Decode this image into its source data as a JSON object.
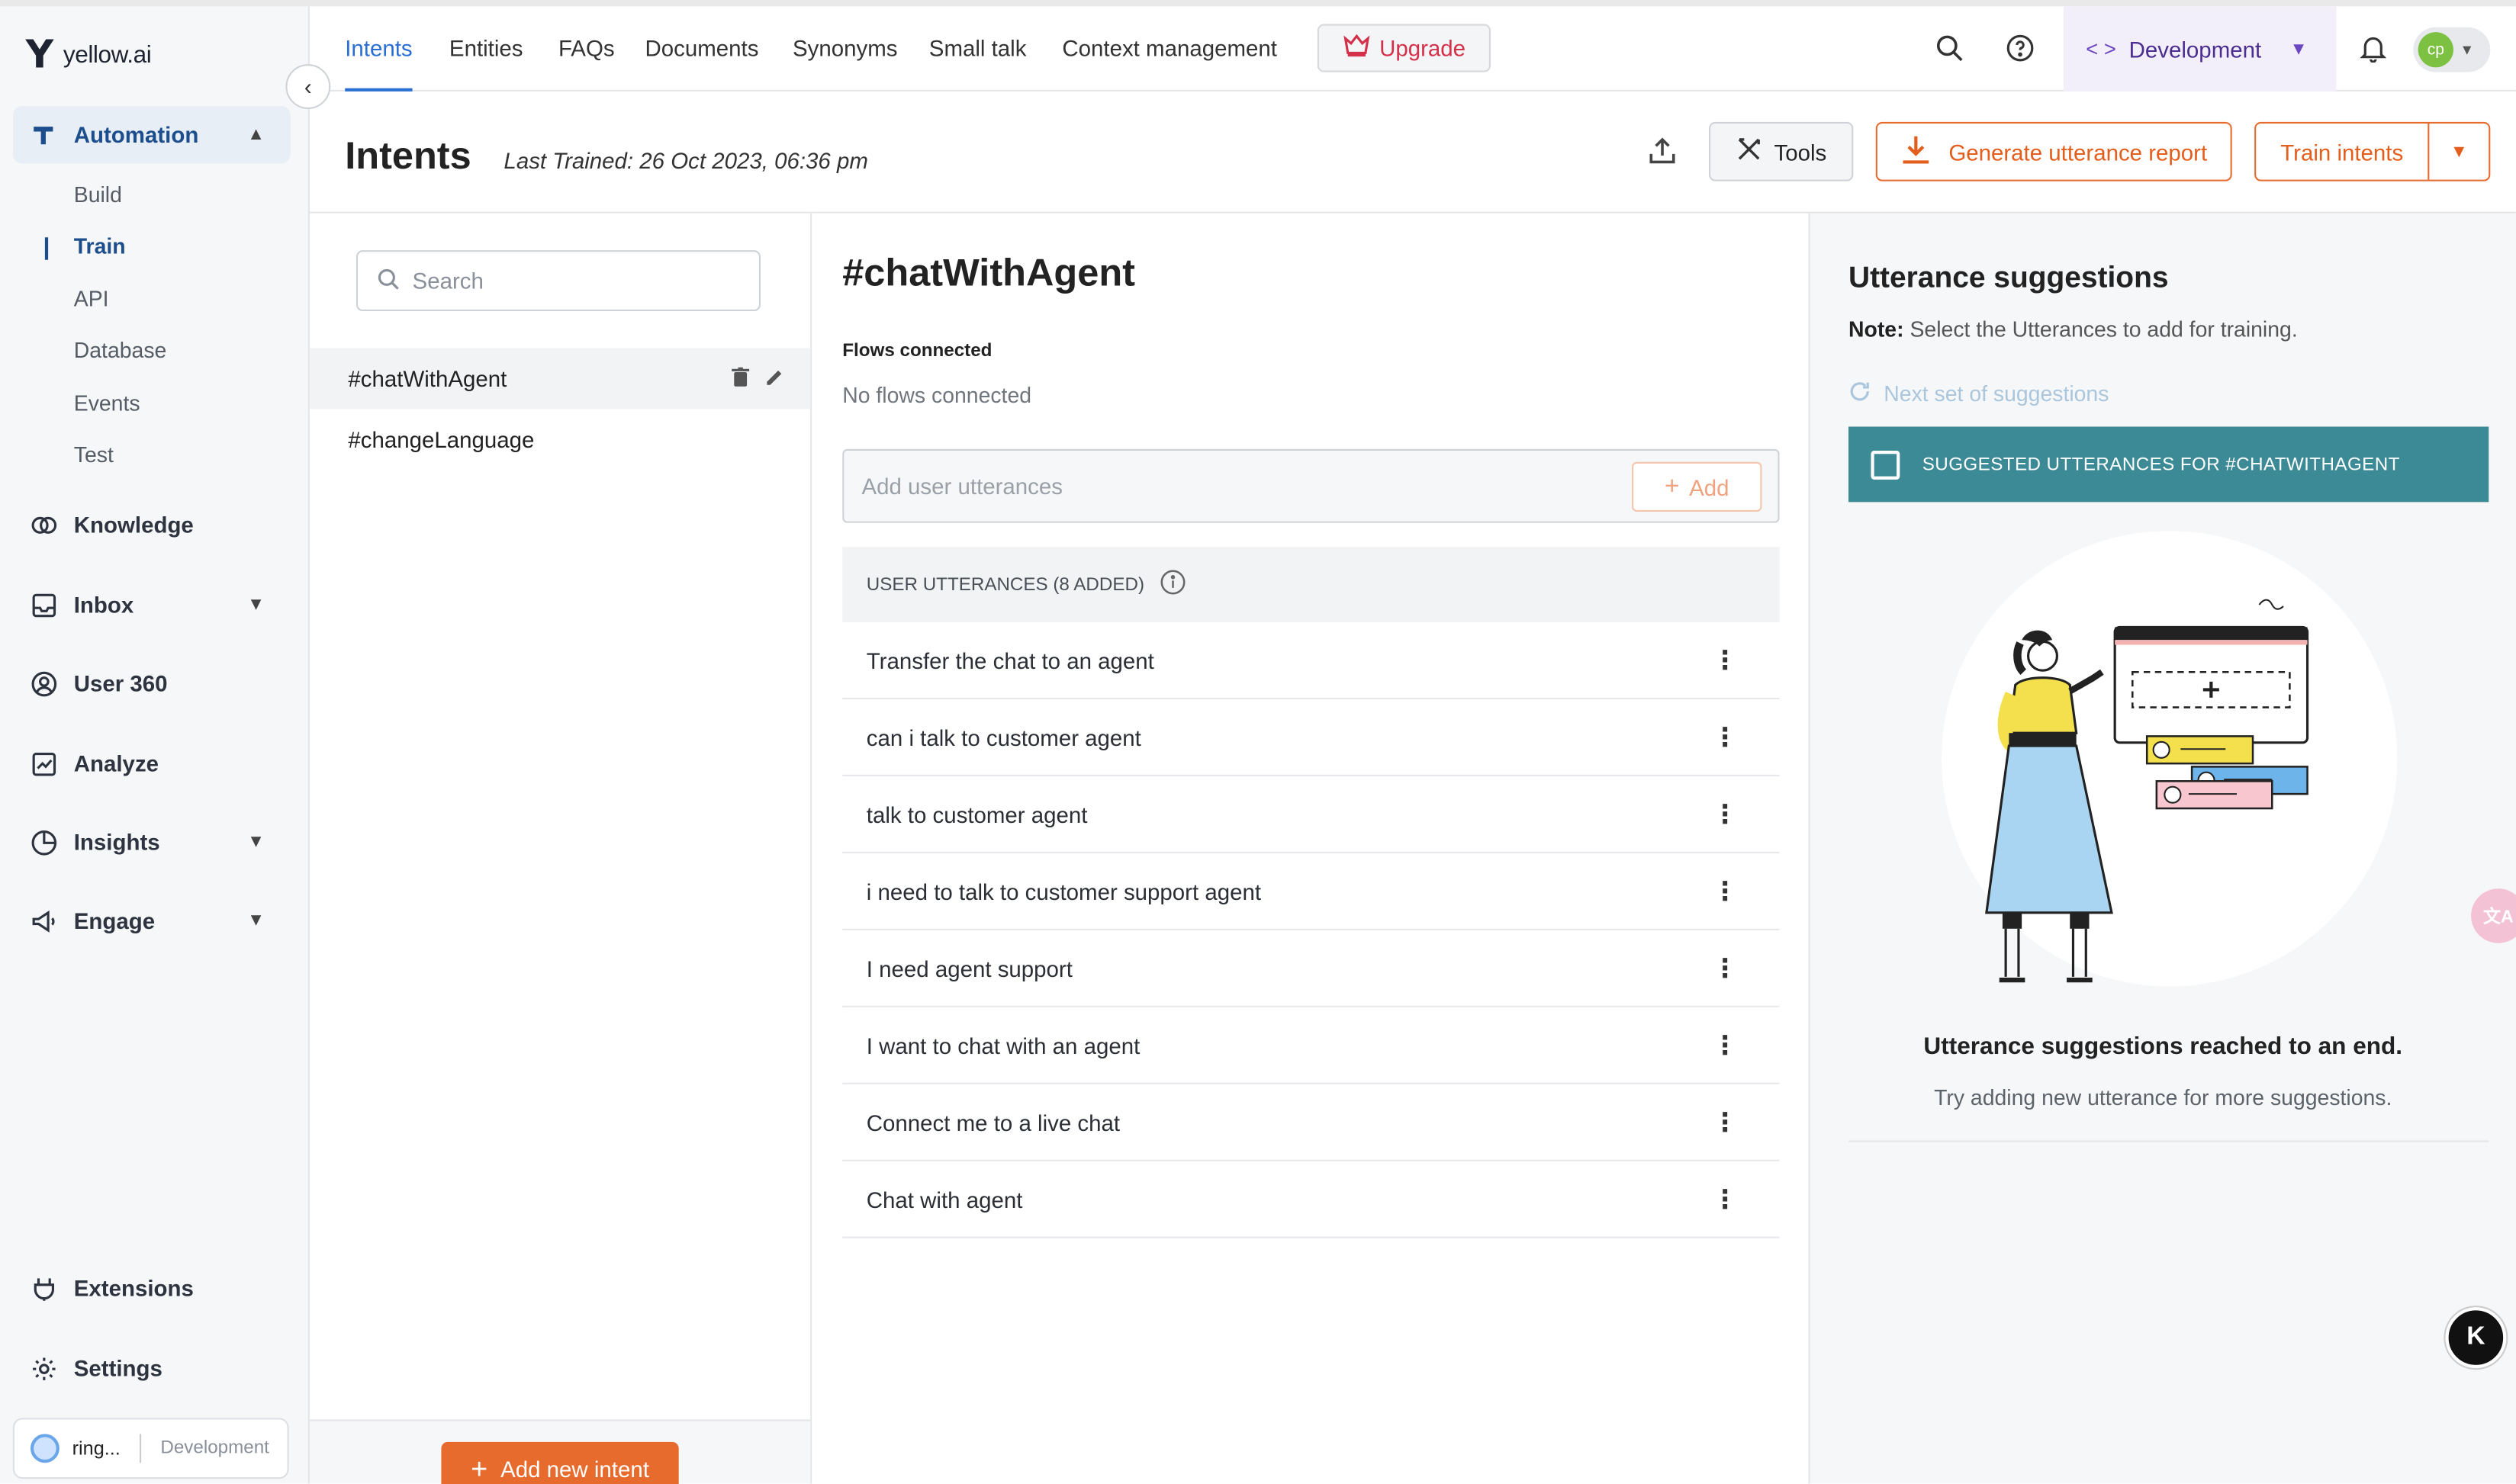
{
  "brand": {
    "name": "yellow.ai"
  },
  "sidebar": {
    "sections": [
      {
        "label": "Automation",
        "icon": "automation-icon",
        "expanded": true
      },
      {
        "label": "Knowledge",
        "icon": "brain-icon"
      },
      {
        "label": "Inbox",
        "icon": "inbox-icon"
      },
      {
        "label": "User 360",
        "icon": "user-circle-icon"
      },
      {
        "label": "Analyze",
        "icon": "chart-icon"
      },
      {
        "label": "Insights",
        "icon": "pie-icon"
      },
      {
        "label": "Engage",
        "icon": "megaphone-icon"
      }
    ],
    "sub_items": [
      "Build",
      "Train",
      "API",
      "Database",
      "Events",
      "Test"
    ],
    "active_sub": "Train",
    "bottom": [
      {
        "label": "Extensions",
        "icon": "plug-icon"
      },
      {
        "label": "Settings",
        "icon": "gear-icon"
      }
    ],
    "workspace": {
      "name": "ring...",
      "env": "Development"
    }
  },
  "topnav": {
    "tabs": [
      "Intents",
      "Entities",
      "FAQs",
      "Documents",
      "Synonyms",
      "Small talk",
      "Context management"
    ],
    "active_tab": "Intents",
    "upgrade_label": "Upgrade",
    "environment": "Development",
    "user_initials": "cp"
  },
  "header": {
    "title": "Intents",
    "last_trained": "Last Trained: 26 Oct 2023, 06:36 pm",
    "tools_label": "Tools",
    "generate_label": "Generate utterance report",
    "train_label": "Train intents"
  },
  "intent_list": {
    "search_placeholder": "Search",
    "items": [
      "#chatWithAgent",
      "#changeLanguage"
    ],
    "selected": "#chatWithAgent",
    "add_label": "Add new intent"
  },
  "intent_detail": {
    "title": "#chatWithAgent",
    "flows_label": "Flows connected",
    "flows_value": "No flows connected",
    "input_placeholder": "Add user utterances",
    "add_label": "Add",
    "utterances_header": "USER UTTERANCES (8 ADDED)",
    "utterances": [
      "Transfer the chat to an agent",
      "can i talk to customer agent",
      "talk to customer agent",
      "i need to talk to customer support agent",
      "I need agent support",
      "I want to chat with an agent",
      "Connect me to a live chat",
      "Chat with agent"
    ]
  },
  "suggestions": {
    "title": "Utterance suggestions",
    "note_bold": "Note:",
    "note_text": "Select the Utterances to add for training.",
    "next_label": "Next set of suggestions",
    "bar_label": "SUGGESTED UTTERANCES FOR #CHATWITHAGENT",
    "end_title": "Utterance suggestions reached to an end.",
    "end_sub": "Try adding new utterance for more suggestions."
  },
  "colors": {
    "primary_blue": "#2a6fd4",
    "accent_orange": "#e86b2e",
    "teal_bar": "#3d8a97",
    "upgrade_red": "#d4304a",
    "env_purple": "#4b2d8f"
  }
}
